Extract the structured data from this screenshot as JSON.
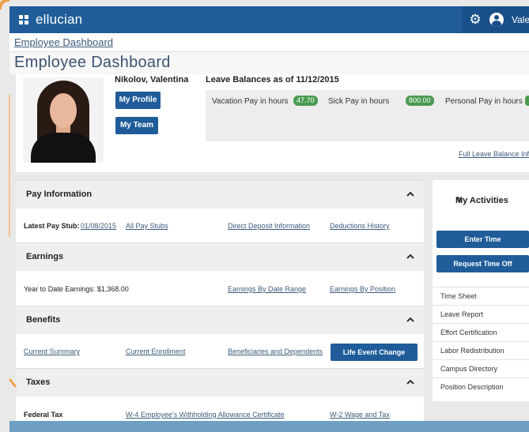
{
  "topbar": {
    "brand": "ellucian",
    "user_name": "Vale"
  },
  "breadcrumb": "Employee Dashboard",
  "page_title": "Employee Dashboard",
  "profile": {
    "name": "Nikolov, Valentina",
    "my_profile_label": "My Profile",
    "my_team_label": "My Team"
  },
  "leave": {
    "title": "Leave Balances as of 11/12/2015",
    "items": [
      {
        "label": "Vacation Pay in hours",
        "value": "47.70"
      },
      {
        "label": "Sick Pay in hours",
        "value": "800.00"
      },
      {
        "label": "Personal Pay in hours",
        "value": ""
      }
    ],
    "full_link": "Full Leave Balance Inf"
  },
  "sections": {
    "pay": {
      "title": "Pay Information",
      "latest_label": "Latest Pay Stub:",
      "latest_date": "01/08/2015",
      "all_stubs": "All Pay Stubs",
      "direct_deposit": "Direct Deposit Information",
      "deductions": "Deductions History"
    },
    "earnings": {
      "title": "Earnings",
      "ytd": "Year to Date Earnings: $1,368.00",
      "by_date": "Earnings By Date Range",
      "by_position": "Earnings By Position"
    },
    "benefits": {
      "title": "Benefits",
      "current_summary": "Current Summary",
      "current_enrollment": "Current Enrollment",
      "beneficiaries": "Beneficiaries and Dependents",
      "life_event": "Life Event Change"
    },
    "taxes": {
      "title": "Taxes",
      "federal": "Federal Tax",
      "w4": "W-4 Employee's Withholding Allowance Certificate",
      "w2": "W-2 Wage and Tax"
    }
  },
  "activities": {
    "title": "My Activities",
    "enter_time": "Enter Time",
    "request_time_off": "Request Time Off",
    "items": [
      "Time Sheet",
      "Leave Report",
      "Effort Certification",
      "Labor Redistribution",
      "Campus Directory",
      "Position Description"
    ]
  }
}
